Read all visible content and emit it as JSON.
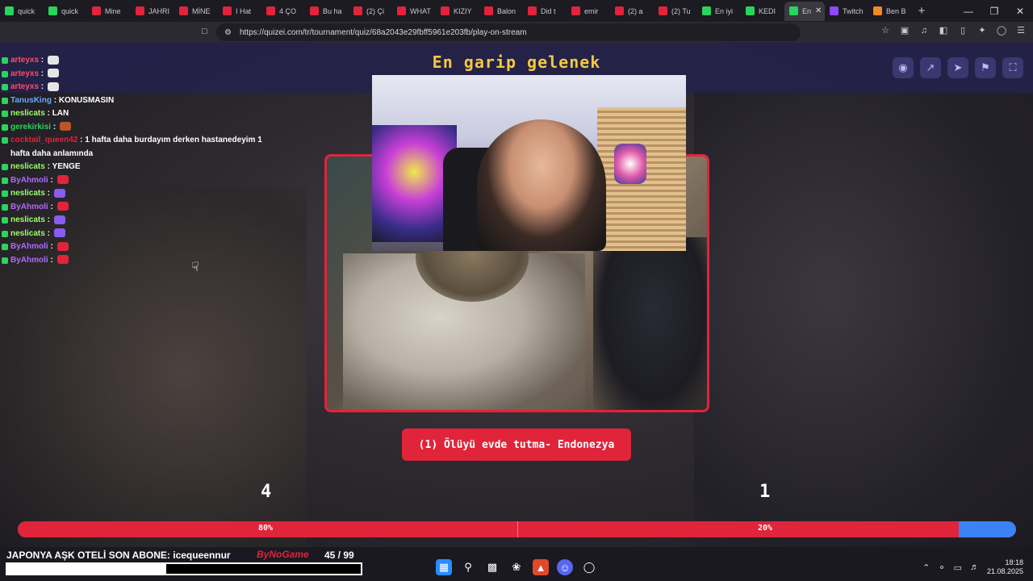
{
  "browser": {
    "tabs": [
      {
        "label": "quick",
        "color": "#2bd45c"
      },
      {
        "label": "quick",
        "color": "#2bd45c"
      },
      {
        "label": "Mine",
        "color": "#e0243a"
      },
      {
        "label": "JAHRI",
        "color": "#e0243a"
      },
      {
        "label": "MİNE",
        "color": "#e0243a"
      },
      {
        "label": "I Hat",
        "color": "#e0243a"
      },
      {
        "label": "4 ÇO",
        "color": "#e0243a"
      },
      {
        "label": "Bu ha",
        "color": "#e0243a"
      },
      {
        "label": "(2) Çi",
        "color": "#e0243a"
      },
      {
        "label": "WHAT",
        "color": "#e0243a"
      },
      {
        "label": "KIZIY",
        "color": "#e0243a"
      },
      {
        "label": "Balon",
        "color": "#e0243a"
      },
      {
        "label": "Did t",
        "color": "#e0243a"
      },
      {
        "label": "emir",
        "color": "#e0243a"
      },
      {
        "label": "(2) a",
        "color": "#e0243a"
      },
      {
        "label": "(2) Tu",
        "color": "#e0243a"
      },
      {
        "label": "En iyi",
        "color": "#2bd45c"
      },
      {
        "label": "KEDI",
        "color": "#2bd45c"
      },
      {
        "label": "En",
        "color": "#2bd45c",
        "active": true
      },
      {
        "label": "Twitch",
        "color": "#9146ff"
      },
      {
        "label": "Ben B",
        "color": "#f08a24"
      }
    ],
    "url": "https://quizei.com/tr/tournament/quiz/68a2043e29fbff5961e203fb/play-on-stream"
  },
  "quiz": {
    "title": "En garip gelenek",
    "caption": "(1) Ölüyü evde tutma- Endonezya",
    "left_votes": "4",
    "right_votes": "1",
    "left_pct_label": "80%",
    "right_pct_label": "20%",
    "left_share": 0.8,
    "right_share": 0.2,
    "accent": "#e0243a",
    "title_color": "#f4c842",
    "right_color": "#3b82f6"
  },
  "chat": [
    {
      "name": "arteyxs",
      "color": "#ff4d6a",
      "message": "",
      "emote": "skull"
    },
    {
      "name": "arteyxs",
      "color": "#ff4d6a",
      "message": "",
      "emote": "skull"
    },
    {
      "name": "arteyxs",
      "color": "#ff4d6a",
      "message": "",
      "emote": "skull"
    },
    {
      "name": "TanusKing",
      "color": "#6aa8ff",
      "message": "KONUSMASIN",
      "emote": ""
    },
    {
      "name": "neslicats",
      "color": "#9dff6a",
      "message": "LAN",
      "emote": ""
    },
    {
      "name": "gerekirkisi",
      "color": "#2bd45c",
      "message": "",
      "emote": "img"
    },
    {
      "name": "cocktail_queen42",
      "color": "#e0243a",
      "message": "1 hafta daha burdayım derken hastanedeyim 1 hafta daha anlamında",
      "emote": ""
    },
    {
      "name": "neslicats",
      "color": "#9dff6a",
      "message": "YENGE",
      "emote": ""
    },
    {
      "name": "ByAhmoli",
      "color": "#b06aff",
      "message": "",
      "emote": "flag"
    },
    {
      "name": "neslicats",
      "color": "#9dff6a",
      "message": "",
      "emote": "swirl"
    },
    {
      "name": "ByAhmoli",
      "color": "#b06aff",
      "message": "",
      "emote": "flag"
    },
    {
      "name": "neslicats",
      "color": "#9dff6a",
      "message": "",
      "emote": "swirl"
    },
    {
      "name": "neslicats",
      "color": "#9dff6a",
      "message": "",
      "emote": "swirl"
    },
    {
      "name": "ByAhmoli",
      "color": "#b06aff",
      "message": "",
      "emote": "flag"
    },
    {
      "name": "ByAhmoli",
      "color": "#b06aff",
      "message": "",
      "emote": "flag"
    }
  ],
  "stream": {
    "label": "JAPONYA AŞK OTELİ  SON ABONE: icequeennur",
    "logo": "ByNoGame",
    "count": "45  / 99",
    "sub_progress": 0.45
  },
  "taskbar": {
    "time": "18:18",
    "date": "21.08.2025"
  }
}
